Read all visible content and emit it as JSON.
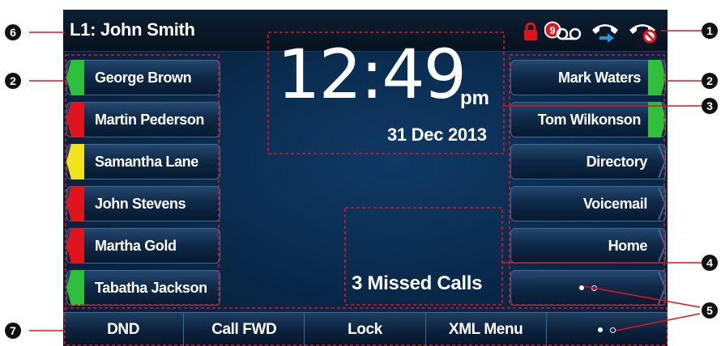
{
  "header": {
    "line_title": "L1: John Smith",
    "status_icons": [
      "lock-icon",
      "voicemail-icon",
      "call-forward-icon",
      "do-not-disturb-icon"
    ],
    "voicemail_count": "9"
  },
  "line_keys_left": [
    {
      "label": "George Brown",
      "led": "green"
    },
    {
      "label": "Martin Pederson",
      "led": "red"
    },
    {
      "label": "Samantha Lane",
      "led": "yellow"
    },
    {
      "label": "John Stevens",
      "led": "red"
    },
    {
      "label": "Martha Gold",
      "led": "red"
    },
    {
      "label": "Tabatha Jackson",
      "led": "green"
    }
  ],
  "line_keys_right": [
    {
      "label": "Mark Waters",
      "led": "green"
    },
    {
      "label": "Tom Wilkonson",
      "led": "green"
    },
    {
      "label": "Directory"
    },
    {
      "label": "Voicemail"
    },
    {
      "label": "Home"
    }
  ],
  "clock": {
    "time": "12:49",
    "ampm": "pm",
    "date": "31 Dec 2013"
  },
  "notifications": {
    "missed_calls": "3 Missed Calls"
  },
  "softkeys": [
    "DND",
    "Call FWD",
    "Lock",
    "XML Menu"
  ],
  "callouts": [
    "1",
    "2",
    "2",
    "3",
    "4",
    "5",
    "6",
    "7"
  ],
  "colors": {
    "screen_bg": "#082747",
    "led_green": "#2fbf3a",
    "led_red": "#e0141d",
    "led_yellow": "#f2e21b",
    "annotation_red": "#e0141d"
  }
}
